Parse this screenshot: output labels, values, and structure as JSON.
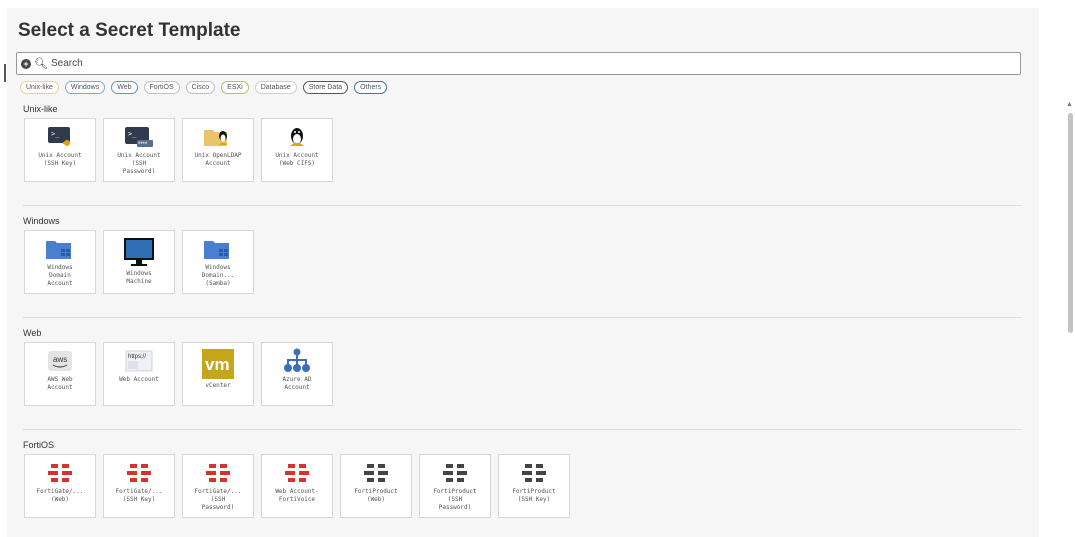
{
  "header": {
    "title": "Select a Secret Template"
  },
  "search": {
    "placeholder": "Search"
  },
  "filters": [
    {
      "label": "Unix-like",
      "color": "#e0d6a0"
    },
    {
      "label": "Windows",
      "color": "#8aa8c8"
    },
    {
      "label": "Web",
      "color": "#7090c0"
    },
    {
      "label": "FortiOS",
      "color": "#c0c0c0"
    },
    {
      "label": "Cisco",
      "color": "#c0c0c0"
    },
    {
      "label": "ESXi",
      "color": "#a8c860"
    },
    {
      "label": "Database",
      "color": "#d0d0d0"
    },
    {
      "label": "Store Data",
      "color": "#555555"
    },
    {
      "label": "Others",
      "color": "#5070a0"
    }
  ],
  "sections": [
    {
      "title": "Unix-like",
      "tiles": [
        {
          "label": "Unix Account\n(SSH Key)",
          "icon": "terminal-key-icon"
        },
        {
          "label": "Unix Account\n(SSH\nPassword)",
          "icon": "terminal-password-icon"
        },
        {
          "label": "Unix OpenLDAP\nAccount",
          "icon": "folder-linux-icon"
        },
        {
          "label": "Unix Account\n(Web CIFS)",
          "icon": "linux-penguin-icon"
        }
      ]
    },
    {
      "title": "Windows",
      "tiles": [
        {
          "label": "Windows\nDomain\nAccount",
          "icon": "windows-folder-icon"
        },
        {
          "label": "Windows\nMachine",
          "icon": "monitor-icon"
        },
        {
          "label": "Windows\nDomain...\n(Samba)",
          "icon": "windows-folder-icon"
        }
      ]
    },
    {
      "title": "Web",
      "tiles": [
        {
          "label": "AWS Web\nAccount",
          "icon": "aws-icon"
        },
        {
          "label": "Web Account",
          "icon": "https-icon"
        },
        {
          "label": "vCenter",
          "icon": "vmware-icon"
        },
        {
          "label": "Azure AD\nAccount",
          "icon": "network-hierarchy-icon"
        }
      ]
    },
    {
      "title": "FortiOS",
      "tiles": [
        {
          "label": "FortiGate/...\n(Web)",
          "icon": "fortinet-red-icon"
        },
        {
          "label": "FortiGate/...\n(SSH Key)",
          "icon": "fortinet-red-icon"
        },
        {
          "label": "FortiGate/...\n(SSH\nPassword)",
          "icon": "fortinet-red-icon"
        },
        {
          "label": "Web Account-\nFortiVoice",
          "icon": "fortinet-red-icon"
        },
        {
          "label": "FortiProduct\n(Web)",
          "icon": "fortinet-dark-icon"
        },
        {
          "label": "FortiProduct\n(SSH\nPassword)",
          "icon": "fortinet-dark-icon"
        },
        {
          "label": "FortiProduct\n(SSH Key)",
          "icon": "fortinet-dark-icon"
        }
      ]
    }
  ]
}
